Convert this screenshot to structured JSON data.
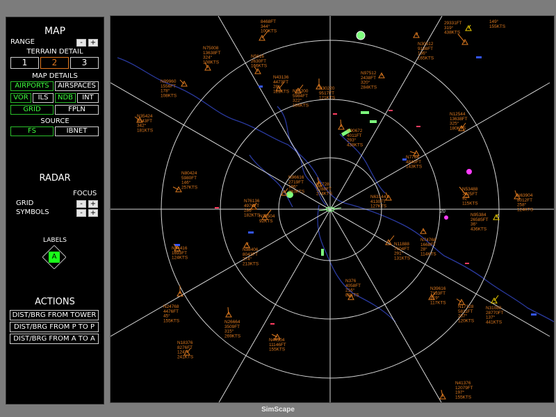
{
  "panel": {
    "map_title": "MAP",
    "range_label": "RANGE",
    "range_minus": "-",
    "range_plus": "+",
    "terrain_title": "TERRAIN DETAIL",
    "terrain_options": [
      "1",
      "2",
      "3"
    ],
    "terrain_selected": "2",
    "map_details_title": "MAP DETAILS",
    "details_buttons": [
      {
        "label": "AIRPORTS",
        "on": true
      },
      {
        "label": "AIRSPACES",
        "on": false
      },
      {
        "label": "VOR",
        "on": true
      },
      {
        "label": "ILS",
        "on": false
      },
      {
        "label": "NDB",
        "on": true
      },
      {
        "label": "INT",
        "on": false
      },
      {
        "label": "GRID",
        "on": true
      },
      {
        "label": "FPLN",
        "on": false
      }
    ],
    "source_title": "SOURCE",
    "source_options": [
      {
        "label": "FS",
        "on": true
      },
      {
        "label": "IBNET",
        "on": false
      }
    ],
    "radar_title": "RADAR",
    "focus_label": "FOCUS",
    "grid_label": "GRID",
    "symbols_label": "SYMBOLS",
    "minus": "-",
    "plus": "+",
    "labels_title": "LABELS",
    "labels_button": "A",
    "actions_title": "ACTIONS",
    "actions": [
      "DIST/BRG FROM TOWER",
      "DIST/BRG FROM P TO P",
      "DIST/BRG FROM A TO A"
    ]
  },
  "radar": {
    "range_ring_label": "20",
    "colors": {
      "grid": "#d8d8d8",
      "aircraft": "#e07b20",
      "airport": "#7dff7d",
      "vor": "#3355ff",
      "river": "#2a3aa0",
      "marker": "#ff3cff",
      "target": "#f0d000"
    },
    "aircraft": [
      {
        "lines": [
          "29331FT",
          "319°",
          "438KTS"
        ]
      },
      {
        "lines": [
          "149°",
          "155KTS"
        ]
      },
      {
        "lines": [
          "N75008",
          "13638FT",
          "324°",
          "108KTS"
        ]
      },
      {
        "lines": [
          "8468FT",
          "344°",
          "100KTS"
        ]
      },
      {
        "lines": [
          "N30512",
          "9198FT",
          "136°",
          "165KTS"
        ]
      },
      {
        "lines": [
          "N5616",
          "2630FT",
          "166KTS"
        ]
      },
      {
        "lines": [
          "N43136",
          "4473FT",
          "28°",
          "121KTS"
        ]
      },
      {
        "lines": [
          "N97512",
          "2438FT",
          "320°",
          "284KTS"
        ]
      },
      {
        "lines": [
          "N99960",
          "1556FT",
          "178°",
          "108KTS"
        ]
      },
      {
        "lines": [
          "N53200",
          "5984FT",
          "322°",
          "184KTS"
        ]
      },
      {
        "lines": [
          "N30220",
          "9517FT",
          "121KTS"
        ]
      },
      {
        "lines": [
          "N35424",
          "5543FT",
          "342°",
          "181KTS"
        ]
      },
      {
        "lines": [
          "N12544",
          "13638FT",
          "325°",
          "180KTS"
        ]
      },
      {
        "lines": [
          "N90672",
          "4011FT",
          "293°",
          "438KTS"
        ]
      },
      {
        "lines": [
          "N80424",
          "5980FT",
          "146°",
          "257KTS"
        ]
      },
      {
        "lines": [
          "N96616",
          "2719FT",
          "196°",
          "283KTS"
        ]
      },
      {
        "lines": [
          "N1728",
          "3288FT",
          "274KTS"
        ]
      },
      {
        "lines": [
          "N7764",
          "4840FT",
          "143KTS"
        ]
      },
      {
        "lines": [
          "N76136",
          "4976FT",
          "286°",
          "182KTS"
        ]
      },
      {
        "lines": [
          "N63904",
          "8012FT",
          "258°",
          "124KTS"
        ]
      },
      {
        "lines": [
          "N53488",
          "7625FT",
          "92°",
          "115KTS"
        ]
      },
      {
        "lines": [
          "N95384",
          "26585FT",
          "36°",
          "436KTS"
        ]
      },
      {
        "lines": [
          "N63144",
          "4130FT",
          "127KTS"
        ]
      },
      {
        "lines": [
          "N35504",
          "92KTS"
        ]
      },
      {
        "lines": [
          "N98406",
          "8043FT",
          "274°",
          "213KTS"
        ]
      },
      {
        "lines": [
          "N94416",
          "1693FT",
          "124KTS"
        ]
      },
      {
        "lines": [
          "N11888",
          "7604FT",
          "291°",
          "131KTS"
        ]
      },
      {
        "lines": [
          "N74768",
          "1668FT",
          "28°",
          "114KTS"
        ]
      },
      {
        "lines": [
          "N376",
          "4058FT",
          "216°",
          "82KTS"
        ]
      },
      {
        "lines": [
          "N39616",
          "7133FT",
          "319°",
          "117KTS"
        ]
      },
      {
        "lines": [
          "N24768",
          "4476FT",
          "45°",
          "155KTS"
        ]
      },
      {
        "lines": [
          "N17128",
          "5811FT",
          "267°",
          "120KTS"
        ]
      },
      {
        "lines": [
          "N31088",
          "28770FT",
          "137°",
          "441KTS"
        ]
      },
      {
        "lines": [
          "N26664",
          "3509FT",
          "315°",
          "269KTS"
        ]
      },
      {
        "lines": [
          "N44504",
          "11146FT",
          "155KTS"
        ]
      },
      {
        "lines": [
          "N18376",
          "8276FT",
          "124°",
          "241KTS"
        ]
      },
      {
        "lines": [
          "N41376",
          "12079FT",
          "197°",
          "155KTS"
        ]
      }
    ]
  },
  "footer": {
    "title": "SimScape"
  }
}
